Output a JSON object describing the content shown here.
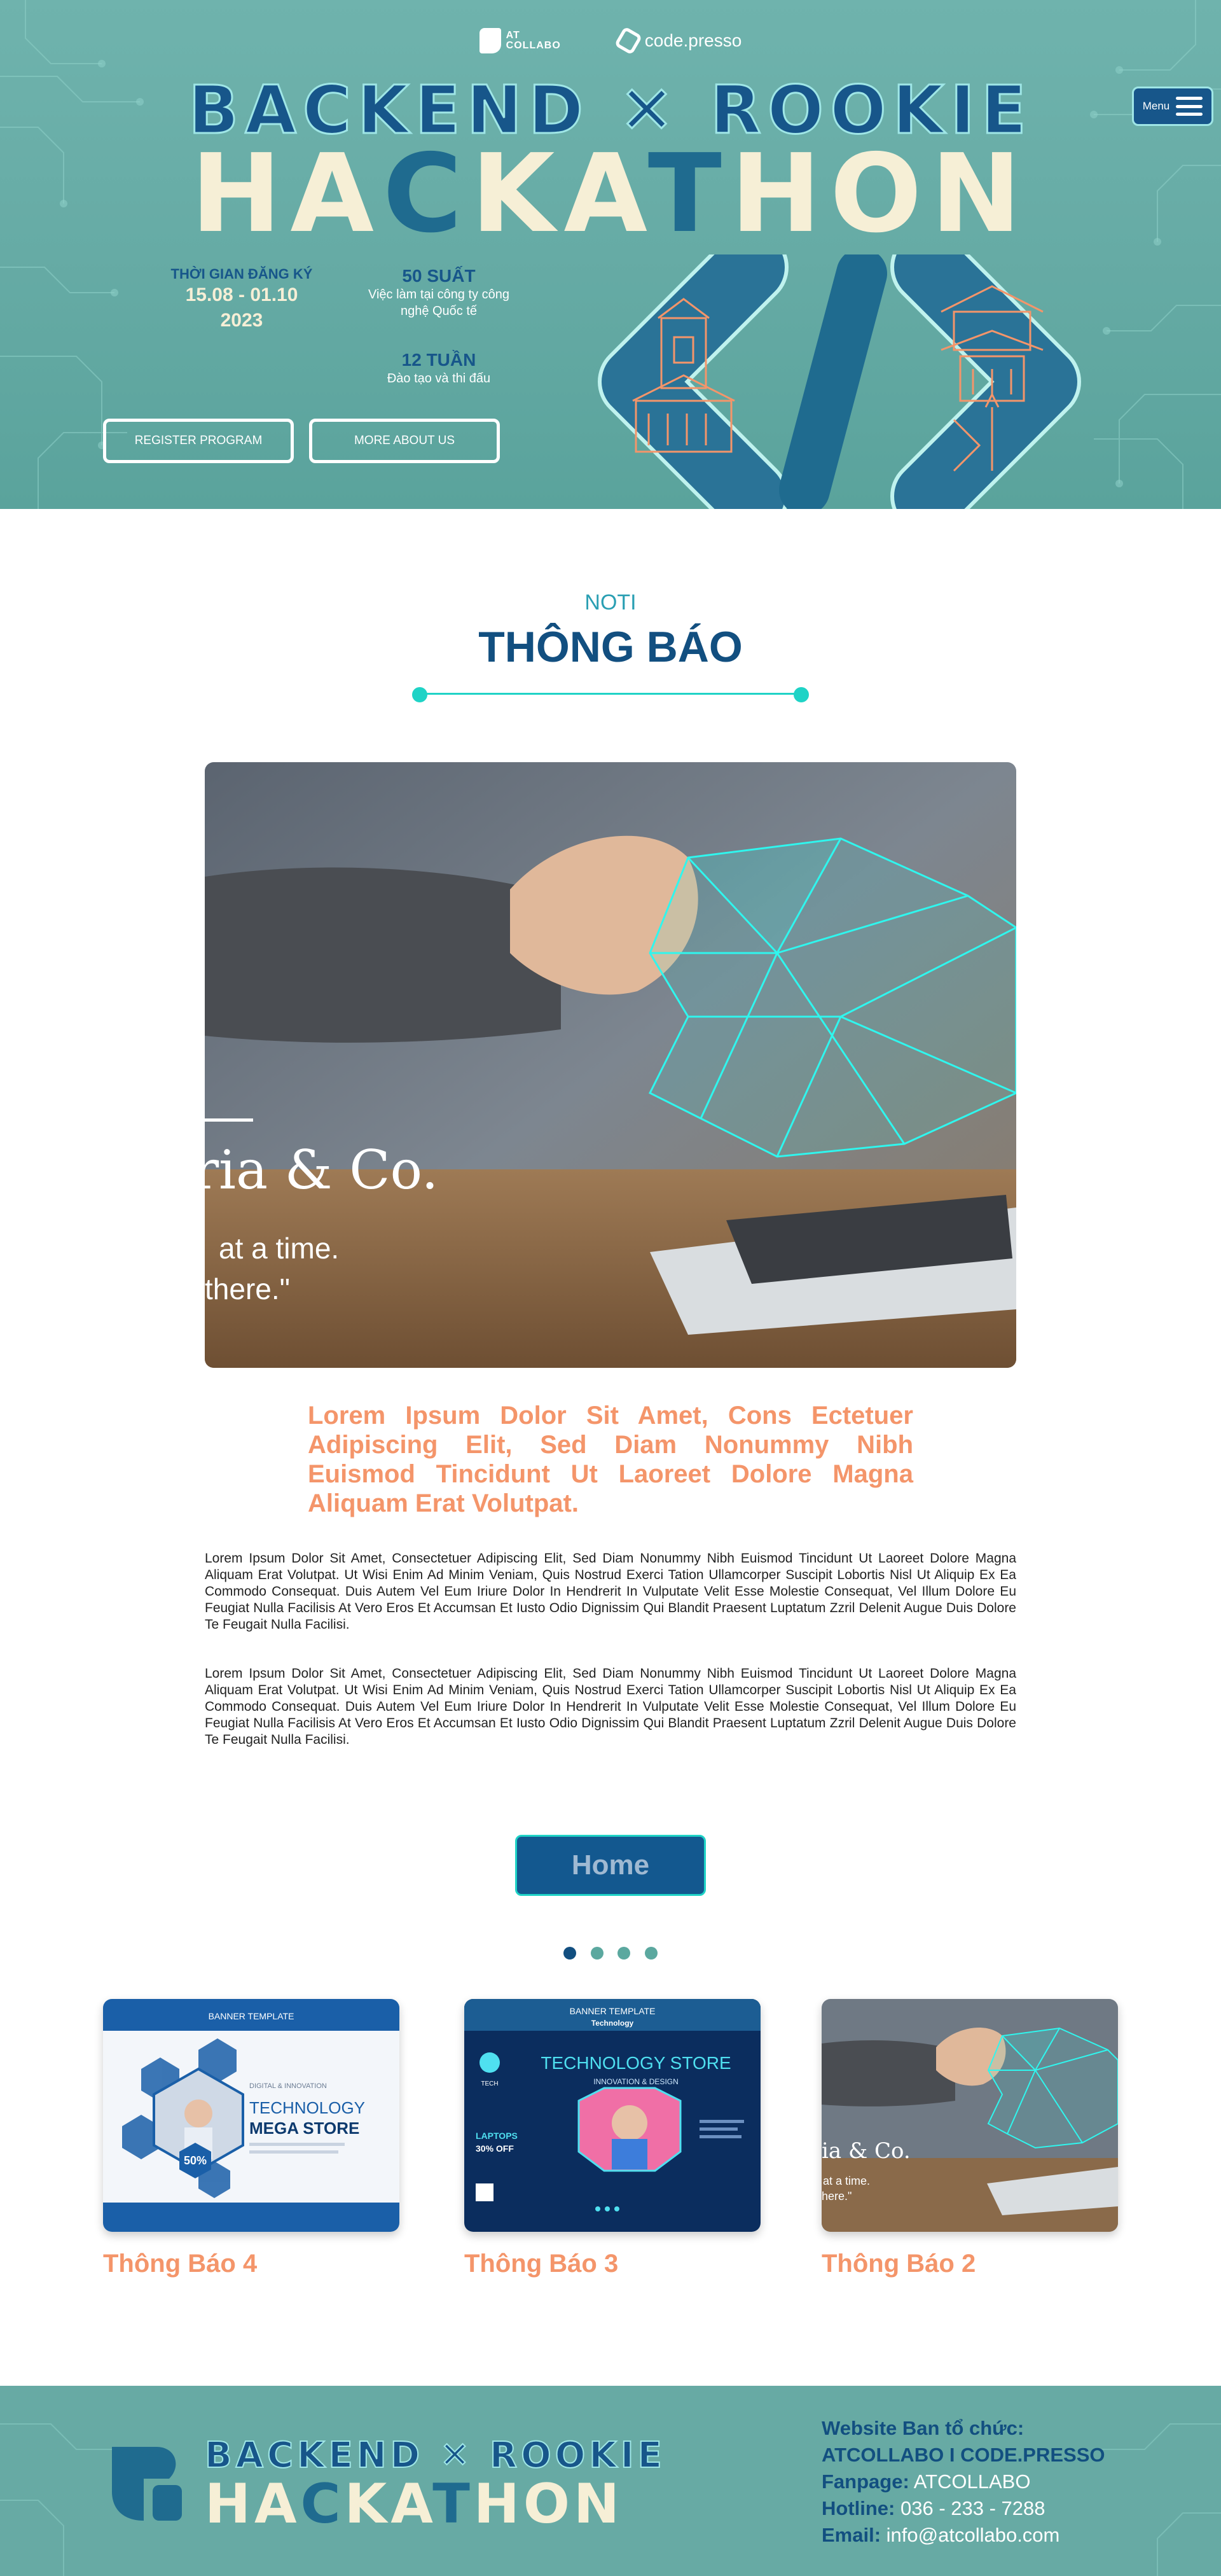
{
  "hero": {
    "logo_atcollabo_line1": "AT",
    "logo_atcollabo_line2": "COLLABO",
    "logo_codepresso": "code.presso",
    "title_line1": "BACKEND ✕ ROOKIE",
    "title_line2_part1": "HA",
    "title_line2_part2": "C",
    "title_line2_part3": "KA",
    "title_line2_part4": "T",
    "title_line2_part5": "HON",
    "registration_label": "THỜI GIAN ĐĂNG KÝ",
    "registration_dates": "15.08 - 01.10",
    "registration_year": "2023",
    "slots_title": "50 SUẤT",
    "slots_desc": "Việc làm tại công ty công nghệ Quốc tế",
    "weeks_title": "12 TUẦN",
    "weeks_desc": "Đào tạo và thi đấu",
    "register_button": "REGISTER PROGRAM",
    "about_button": "MORE ABOUT US",
    "menu_label": "Menu"
  },
  "noti": {
    "subtitle": "NOTI",
    "title": "THÔNG BÁO",
    "image_caption_brand": "ria & Co.",
    "image_caption_line1": "at a time.",
    "image_caption_line2": "there.\"",
    "lead": "Lorem Ipsum Dolor Sit Amet, Cons Ectetuer Adipiscing Elit, Sed Diam Nonummy Nibh Euismod Tincidunt Ut Laoreet Dolore Magna Aliquam Erat Volutpat.",
    "paragraph1": "Lorem Ipsum Dolor Sit Amet, Consectetuer Adipiscing Elit, Sed Diam Nonummy Nibh Euismod Tincidunt Ut Laoreet Dolore Magna Aliquam Erat Volutpat. Ut Wisi Enim Ad Minim Veniam, Quis Nostrud Exerci Tation Ullamcorper Suscipit Lobortis Nisl Ut Aliquip Ex Ea Commodo Consequat. Duis Autem Vel Eum Iriure Dolor In Hendrerit In Vulputate Velit Esse Molestie Consequat, Vel Illum Dolore Eu Feugiat Nulla Facilisis At Vero Eros Et Accumsan Et Iusto Odio Dignissim Qui Blandit Praesent Luptatum Zzril Delenit Augue Duis Dolore Te Feugait Nulla Facilisi.",
    "paragraph2": "Lorem Ipsum Dolor Sit Amet, Consectetuer Adipiscing Elit, Sed Diam Nonummy Nibh Euismod Tincidunt Ut Laoreet Dolore Magna Aliquam Erat Volutpat. Ut Wisi Enim Ad Minim Veniam, Quis Nostrud Exerci Tation Ullamcorper Suscipit Lobortis Nisl Ut Aliquip Ex Ea Commodo Consequat. Duis Autem Vel Eum Iriure Dolor In Hendrerit In Vulputate Velit Esse Molestie Consequat, Vel Illum Dolore Eu Feugiat Nulla Facilisis At Vero Eros Et Accumsan Et Iusto Odio Dignissim Qui Blandit Praesent Luptatum Zzril Delenit Augue Duis Dolore Te Feugait Nulla Facilisi.",
    "home_button": "Home"
  },
  "carousel": {
    "dot_count": 4,
    "active_index": 0
  },
  "cards": [
    {
      "title": "Thông Báo 4",
      "banner_label": "BANNER TEMPLATE",
      "tag": "DIGITAL & INNOVATION",
      "heading1": "TECHNOLOGY",
      "heading2": "MEGA STORE",
      "badge": "50%"
    },
    {
      "title": "Thông Báo 3",
      "banner_label": "BANNER TEMPLATE",
      "banner_sub": "Technology",
      "heading1": "TECHNOLOGY STORE",
      "heading2": "INNOVATION & DESIGN",
      "badge_line1": "LAPTOPS",
      "badge_line2": "30% OFF",
      "brand": "TECH"
    },
    {
      "title": "Thông Báo 2",
      "caption_brand": "ia & Co.",
      "caption_line1": "at a time.",
      "caption_line2": "here.\""
    }
  ],
  "footer": {
    "title_line1": "BACKEND ✕ ROOKIE",
    "title_line2_part1": "HA",
    "title_line2_part2": "C",
    "title_line2_part3": "KA",
    "title_line2_part4": "T",
    "title_line2_part5": "HON",
    "website_label": "Website Ban tổ chức:",
    "website_value": "ATCOLLABO I CODE.PRESSO",
    "fanpage_label": "Fanpage:",
    "fanpage_value": "ATCOLLABO",
    "hotline_label": "Hotline:",
    "hotline_value": "036 - 233 - 7288",
    "email_label": "Email:",
    "email_value": "info@atcollabo.com"
  },
  "colors": {
    "teal_bg": "#67aaa4",
    "navy": "#124f80",
    "accent_cyan": "#1fd3c6",
    "salmon": "#f4956a",
    "cream": "#f6efd6"
  }
}
